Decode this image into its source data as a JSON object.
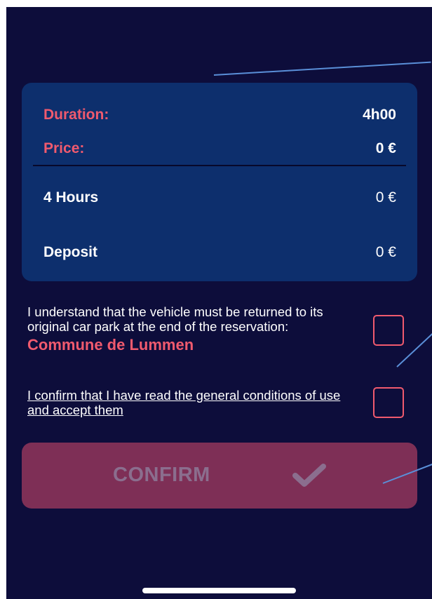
{
  "summary": {
    "duration_label": "Duration:",
    "duration_value": "4h00",
    "price_label": "Price:",
    "price_value": "0 €",
    "items": [
      {
        "label": "4 Hours",
        "value": "0 €"
      },
      {
        "label": "Deposit",
        "value": "0 €"
      }
    ]
  },
  "terms": {
    "return_notice": "I understand that the vehicle must be returned to its original car park at the end of the reservation:",
    "car_park_name": "Commune de Lummen",
    "conditions_link": "I confirm that I have read the general conditions of use and accept them"
  },
  "confirm": {
    "label": "CONFIRM",
    "icon": "checkmark-icon"
  },
  "colors": {
    "background": "#0d0d3b",
    "card": "#0d2f6d",
    "accent": "#f05a6e",
    "button_disabled": "#7e2f56"
  }
}
